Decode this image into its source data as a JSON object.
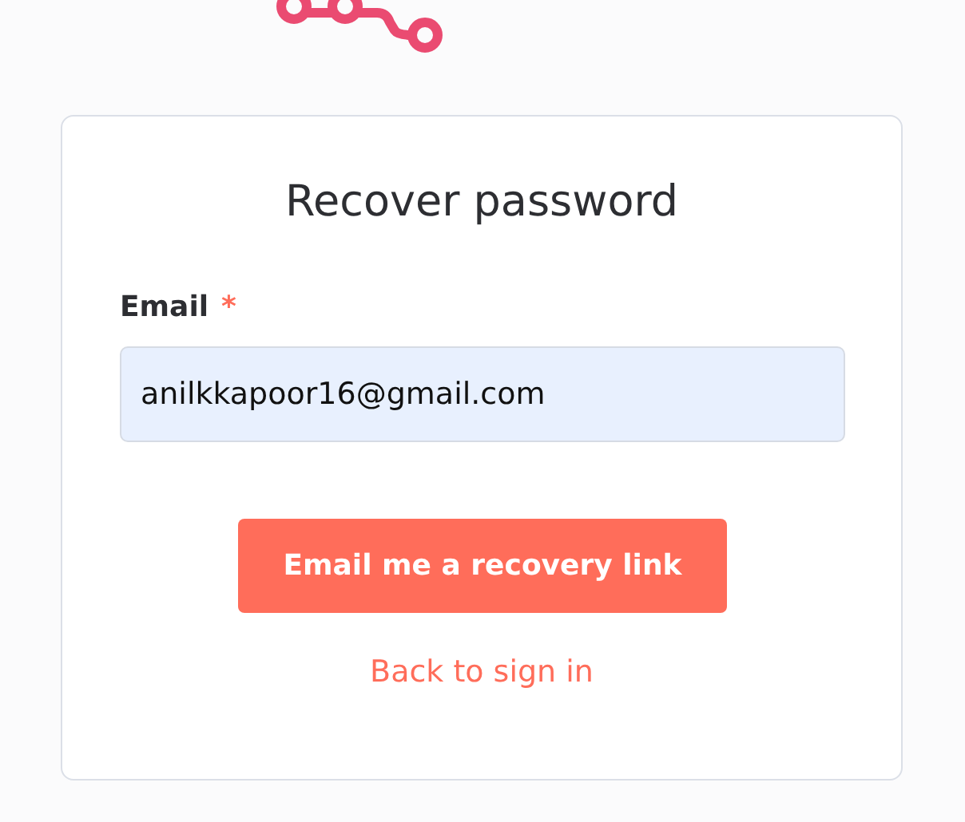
{
  "title": "Recover password",
  "field": {
    "label": "Email",
    "required_mark": "*",
    "value": "anilkkapoor16@gmail.com"
  },
  "button": "Email me a recovery link",
  "link": "Back to sign in"
}
